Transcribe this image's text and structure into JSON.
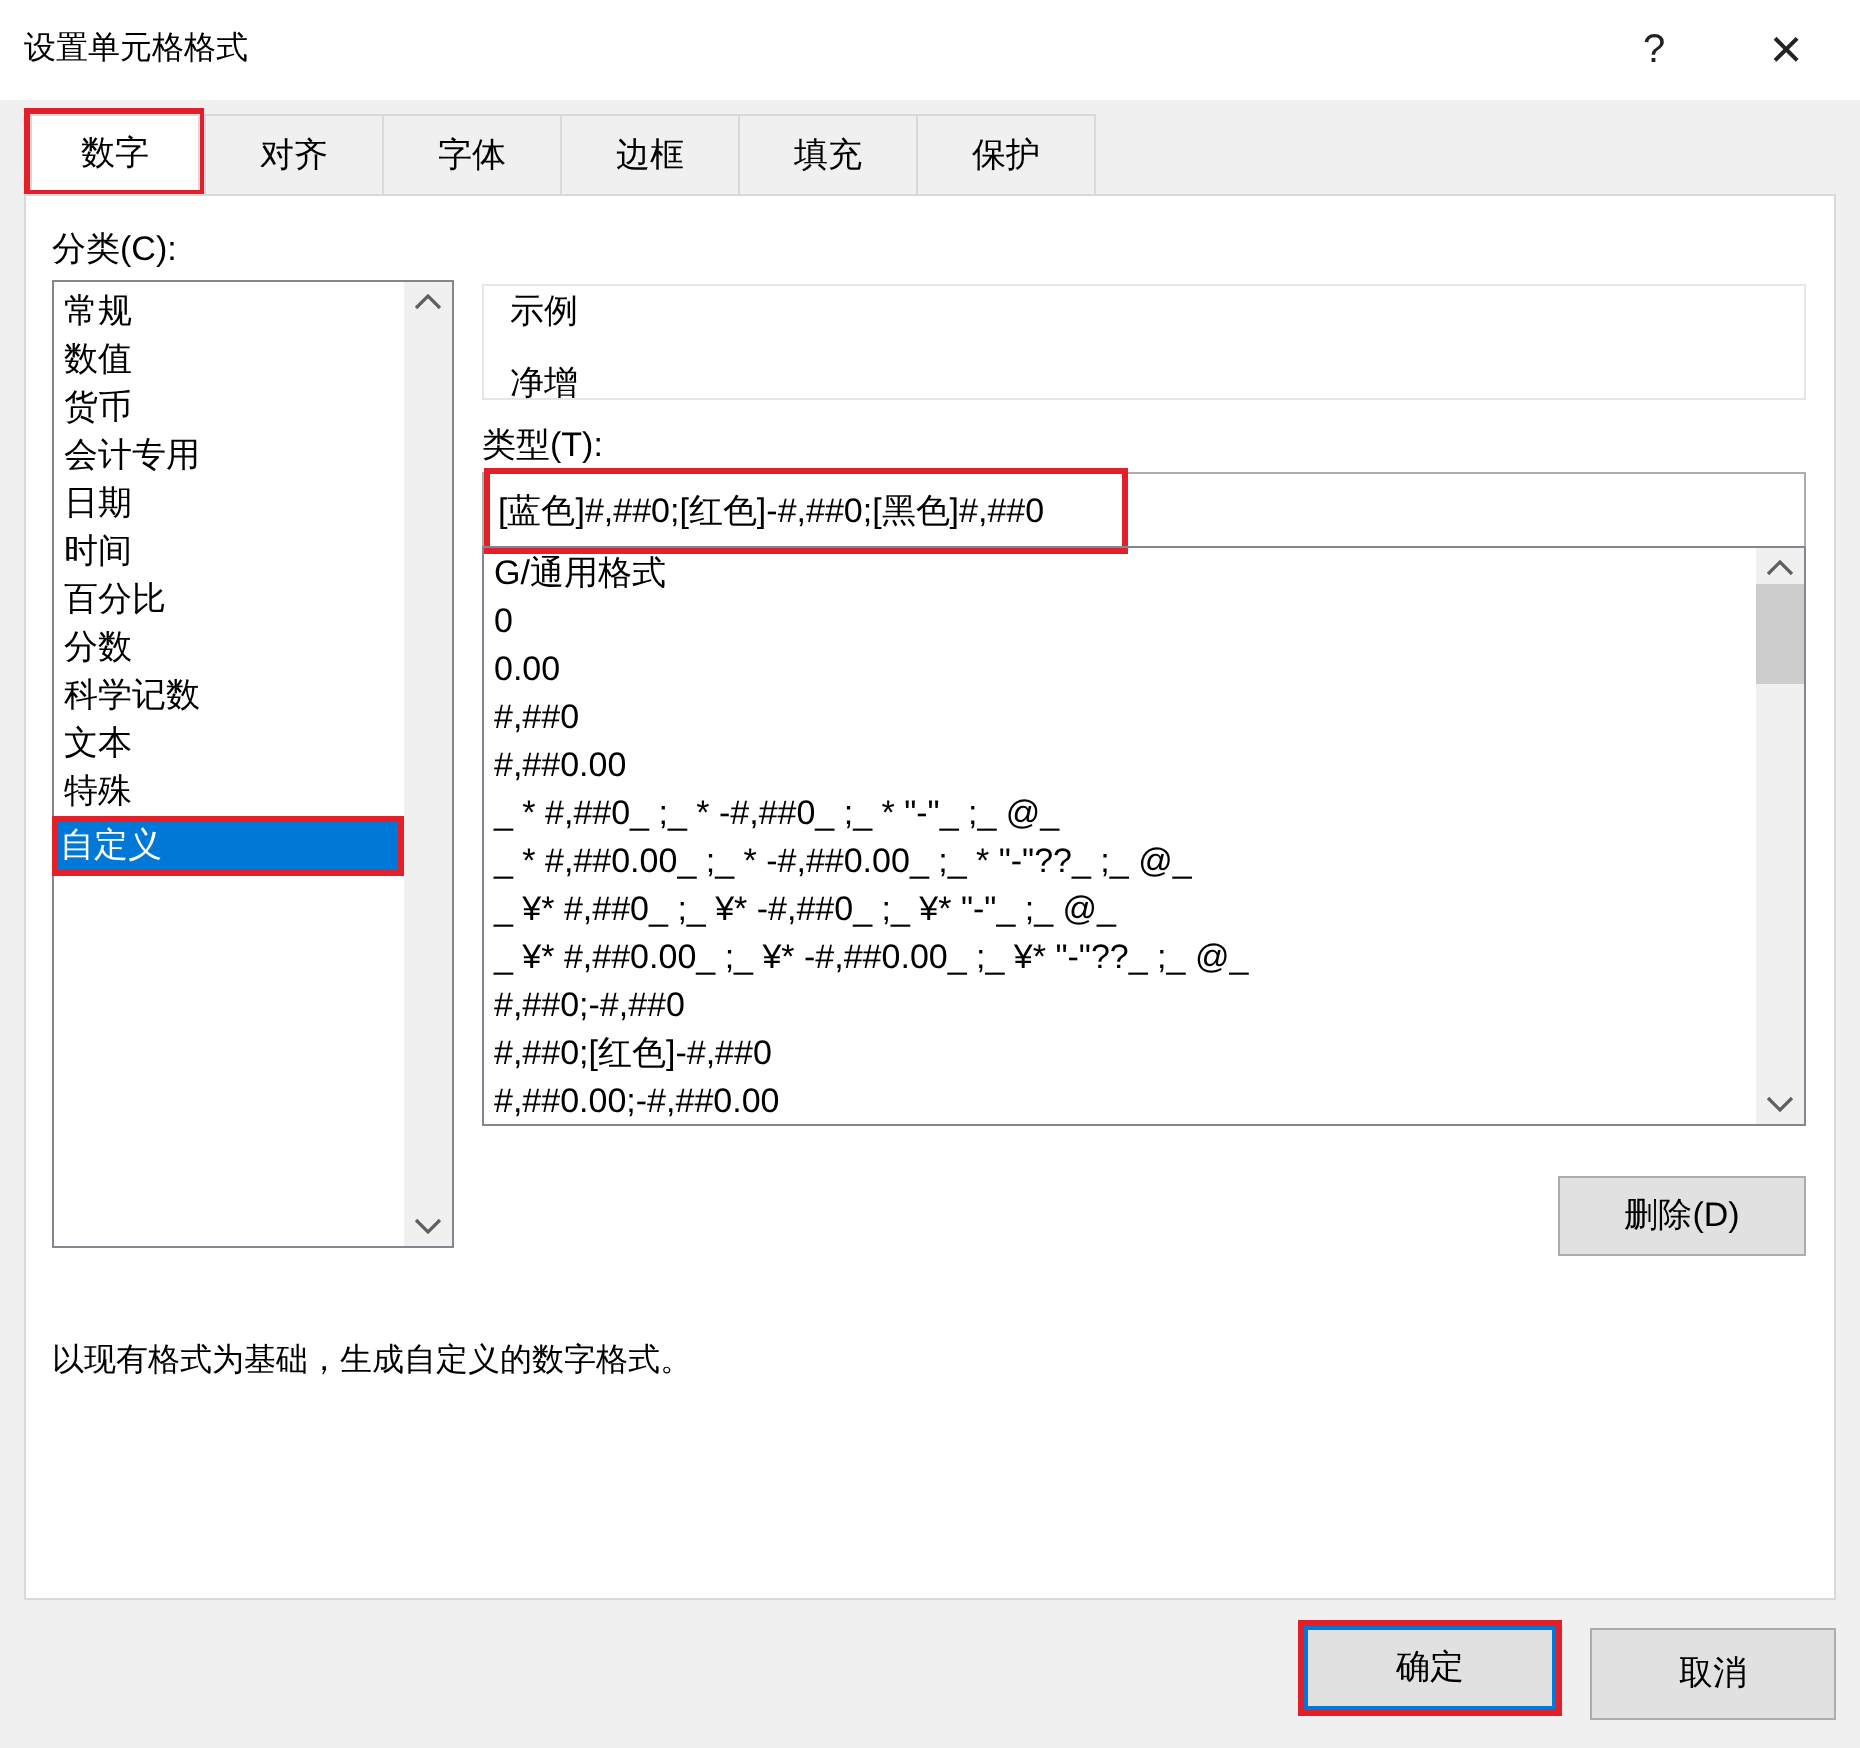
{
  "window": {
    "title": "设置单元格格式",
    "help": "?",
    "close": "×"
  },
  "tabs": [
    {
      "label": "数字",
      "selected": true,
      "highlighted": true
    },
    {
      "label": "对齐",
      "selected": false,
      "highlighted": false
    },
    {
      "label": "字体",
      "selected": false,
      "highlighted": false
    },
    {
      "label": "边框",
      "selected": false,
      "highlighted": false
    },
    {
      "label": "填充",
      "selected": false,
      "highlighted": false
    },
    {
      "label": "保护",
      "selected": false,
      "highlighted": false
    }
  ],
  "category": {
    "label": "分类(C):",
    "items": [
      {
        "label": "常规",
        "selected": false,
        "highlighted": false
      },
      {
        "label": "数值",
        "selected": false,
        "highlighted": false
      },
      {
        "label": "货币",
        "selected": false,
        "highlighted": false
      },
      {
        "label": "会计专用",
        "selected": false,
        "highlighted": false
      },
      {
        "label": "日期",
        "selected": false,
        "highlighted": false
      },
      {
        "label": "时间",
        "selected": false,
        "highlighted": false
      },
      {
        "label": "百分比",
        "selected": false,
        "highlighted": false
      },
      {
        "label": "分数",
        "selected": false,
        "highlighted": false
      },
      {
        "label": "科学记数",
        "selected": false,
        "highlighted": false
      },
      {
        "label": "文本",
        "selected": false,
        "highlighted": false
      },
      {
        "label": "特殊",
        "selected": false,
        "highlighted": false
      },
      {
        "label": "自定义",
        "selected": true,
        "highlighted": true
      }
    ]
  },
  "sample": {
    "label": "示例",
    "value": "净增"
  },
  "type": {
    "label": "类型(T):",
    "value": "[蓝色]#,##0;[红色]-#,##0;[黑色]#,##0",
    "highlighted": true,
    "items": [
      {
        "label": "G/通用格式",
        "selected": false
      },
      {
        "label": "0",
        "selected": false
      },
      {
        "label": "0.00",
        "selected": false
      },
      {
        "label": "#,##0",
        "selected": false
      },
      {
        "label": "#,##0.00",
        "selected": false
      },
      {
        "label": "_ * #,##0_ ;_ * -#,##0_ ;_ * \"-\"_ ;_ @_",
        "selected": false
      },
      {
        "label": "_ * #,##0.00_ ;_ * -#,##0.00_ ;_ * \"-\"??_ ;_ @_",
        "selected": false
      },
      {
        "label": "_ ¥* #,##0_ ;_ ¥* -#,##0_ ;_ ¥* \"-\"_ ;_ @_",
        "selected": false
      },
      {
        "label": "_ ¥* #,##0.00_ ;_ ¥* -#,##0.00_ ;_ ¥* \"-\"??_ ;_ @_",
        "selected": false
      },
      {
        "label": "#,##0;-#,##0",
        "selected": false
      },
      {
        "label": "#,##0;[红色]-#,##0",
        "selected": false
      },
      {
        "label": "#,##0.00;-#,##0.00",
        "selected": false
      }
    ]
  },
  "delete_button": "删除(D)",
  "description": "以现有格式为基础，生成自定义的数字格式。",
  "buttons": [
    {
      "label": "确定",
      "kind": "default",
      "highlighted": true
    },
    {
      "label": "取消",
      "kind": "normal",
      "highlighted": false
    }
  ]
}
